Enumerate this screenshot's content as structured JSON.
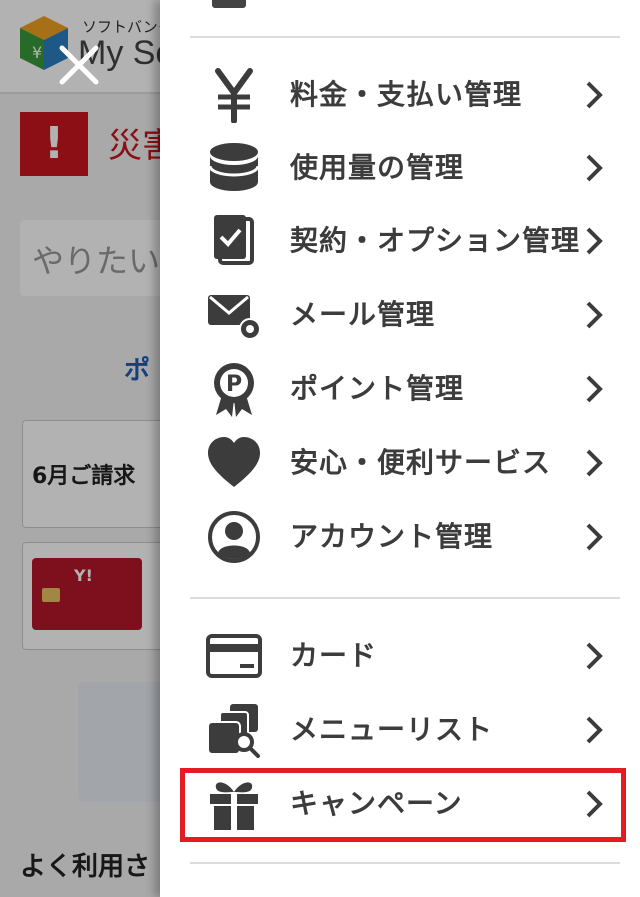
{
  "background": {
    "logo_small_text": "ソフトバンク",
    "logo_big_text": "My So",
    "alert_mark": "!",
    "alert_text": "災害",
    "search_placeholder": "やりたい",
    "point_text": "ポ",
    "billing_text": "6月ご請求",
    "card_brand": "Y!",
    "frequently_used": "よく利用さ"
  },
  "drawer": {
    "group1": [
      {
        "label": "料金・支払い管理",
        "icon": "yen-icon"
      },
      {
        "label": "使用量の管理",
        "icon": "database-icon"
      },
      {
        "label": "契約・オプション管理",
        "icon": "contract-icon"
      },
      {
        "label": "メール管理",
        "icon": "mail-settings-icon"
      },
      {
        "label": "ポイント管理",
        "icon": "point-badge-icon"
      },
      {
        "label": "安心・便利サービス",
        "icon": "heart-icon"
      },
      {
        "label": "アカウント管理",
        "icon": "account-icon"
      }
    ],
    "group2": [
      {
        "label": "カード",
        "icon": "credit-card-icon"
      },
      {
        "label": "メニューリスト",
        "icon": "menu-list-icon"
      },
      {
        "label": "キャンペーン",
        "icon": "gift-icon"
      }
    ]
  },
  "colors": {
    "icon": "#3c3c3c",
    "highlight": "#e31c23",
    "alert": "#c8161d"
  }
}
